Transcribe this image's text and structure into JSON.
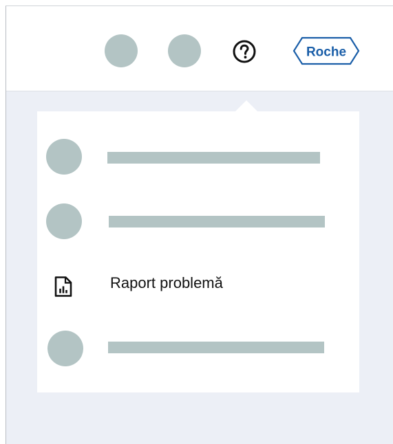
{
  "header": {
    "help_icon": "help-circle-icon",
    "logo_text": "Roche"
  },
  "menu": {
    "items": [
      {
        "type": "placeholder"
      },
      {
        "type": "placeholder"
      },
      {
        "type": "action",
        "icon": "report-chart-icon",
        "label": "Raport problemă"
      },
      {
        "type": "placeholder"
      }
    ]
  },
  "colors": {
    "placeholder": "#b3c4c4",
    "content_background": "#eceff6",
    "logo_blue": "#1a5ea8"
  }
}
